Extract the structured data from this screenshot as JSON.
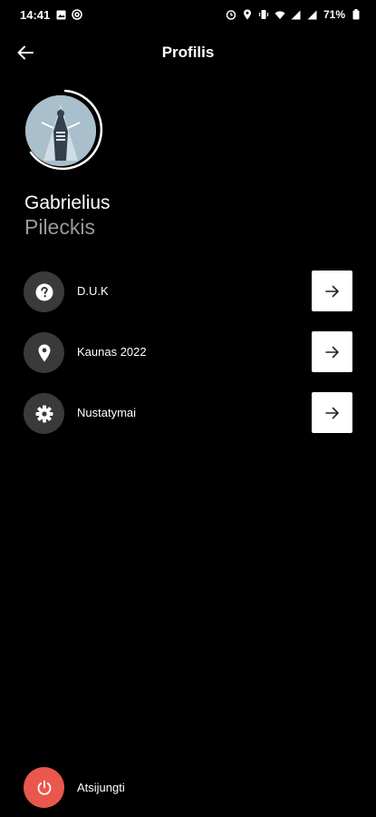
{
  "status_bar": {
    "time": "14:41",
    "battery": "71%",
    "icons_left": [
      "image-icon",
      "at-icon"
    ],
    "icons_right": [
      "alarm-icon",
      "location-icon",
      "vibrate-icon",
      "wifi-icon",
      "signal-icon",
      "signal-icon",
      "battery-icon"
    ]
  },
  "header": {
    "title": "Profilis",
    "back_icon": "arrow-left-icon"
  },
  "profile": {
    "first_name": "Gabrielius",
    "last_name": "Pileckis"
  },
  "menu": {
    "items": [
      {
        "label": "D.U.K",
        "icon": "question-icon"
      },
      {
        "label": "Kaunas 2022",
        "icon": "location-pin-icon"
      },
      {
        "label": "Nustatymai",
        "icon": "gear-icon"
      }
    ]
  },
  "logout": {
    "label": "Atsijungti",
    "icon": "power-icon"
  },
  "colors": {
    "background": "#000000",
    "icon_circle": "#3a3a3a",
    "arrow_button": "#ffffff",
    "logout_accent": "#e9574d",
    "last_name_gray": "#9a9a9a"
  }
}
